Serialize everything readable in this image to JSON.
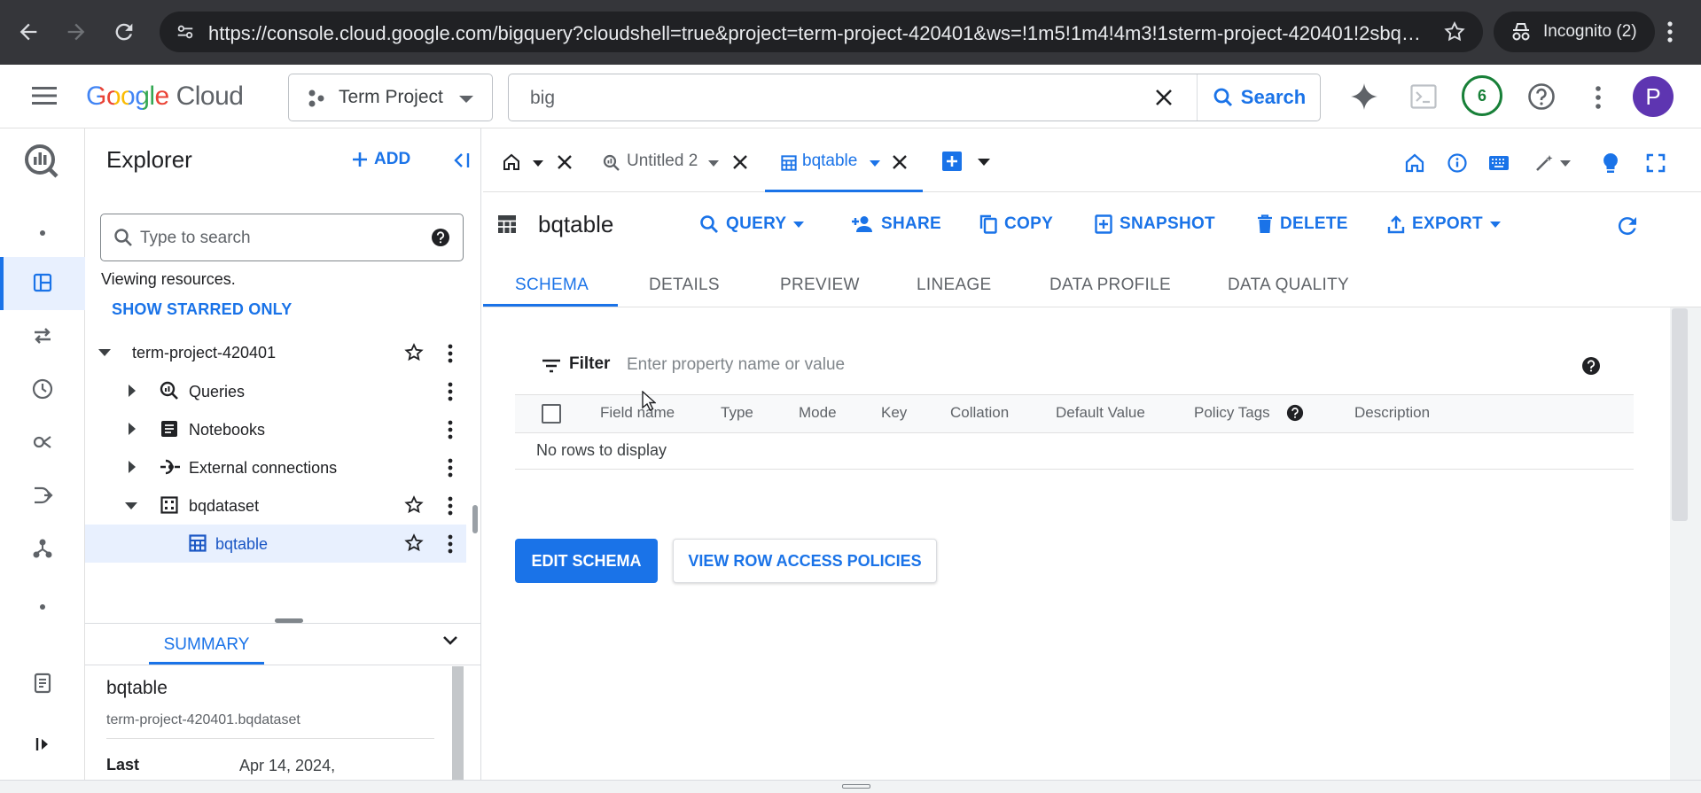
{
  "browser": {
    "url": "https://console.cloud.google.com/bigquery?cloudshell=true&project=term-project-420401&ws=!1m5!1m4!4m3!1sterm-project-420401!2sbqdata...",
    "incognito_label": "Incognito (2)"
  },
  "header": {
    "logo_google": "Google",
    "logo_cloud": "Cloud",
    "project": "Term Project",
    "search_value": "big",
    "search_button": "Search",
    "notif_count": "6",
    "avatar_letter": "P"
  },
  "explorer": {
    "title": "Explorer",
    "add_label": "ADD",
    "search_placeholder": "Type to search",
    "viewing_text": "Viewing resources.",
    "show_starred": "SHOW STARRED ONLY",
    "project": "term-project-420401",
    "items": [
      {
        "label": "Queries"
      },
      {
        "label": "Notebooks"
      },
      {
        "label": "External connections"
      },
      {
        "label": "bqdataset"
      },
      {
        "label": "bqtable"
      }
    ],
    "summary_tab": "SUMMARY",
    "summary_title": "bqtable",
    "summary_path": "term-project-420401.bqdataset",
    "summary_last_label": "Last",
    "summary_last_value": "Apr 14, 2024,"
  },
  "tabs": [
    {
      "label": "Untitled 2"
    },
    {
      "label": "bqtable"
    }
  ],
  "table": {
    "name": "bqtable",
    "actions": {
      "query": "QUERY",
      "share": "SHARE",
      "copy": "COPY",
      "snapshot": "SNAPSHOT",
      "delete": "DELETE",
      "export": "EXPORT"
    },
    "subtabs": [
      "SCHEMA",
      "DETAILS",
      "PREVIEW",
      "LINEAGE",
      "DATA PROFILE",
      "DATA QUALITY"
    ],
    "filter_label": "Filter",
    "filter_placeholder": "Enter property name or value",
    "columns": [
      "Field name",
      "Type",
      "Mode",
      "Key",
      "Collation",
      "Default Value",
      "Policy Tags",
      "Description"
    ],
    "empty_text": "No rows to display",
    "edit_schema": "EDIT SCHEMA",
    "view_policies": "VIEW ROW ACCESS POLICIES"
  },
  "colors": {
    "accent": "#1a73e8",
    "chrome_dark": "#35363a",
    "avatar": "#5e35b1",
    "notif": "#188038"
  }
}
